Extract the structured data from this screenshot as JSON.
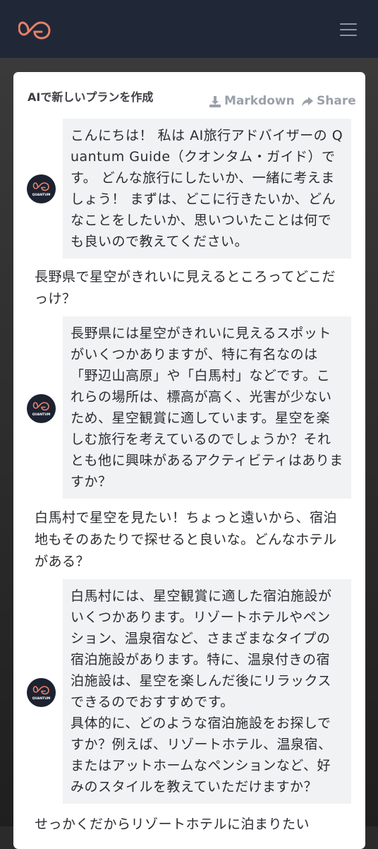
{
  "header": {
    "logo_name": "quantum-guide-logo",
    "menu_icon": "hamburger-menu-icon"
  },
  "chat": {
    "title": "AIで新しいプランを作成",
    "actions": {
      "markdown_label": "Markdown",
      "share_label": "Share"
    },
    "messages": [
      {
        "role": "assistant",
        "text": "こんにちは！ 私は AI旅行アドバイザーの Quantum Guide（クオンタム・ガイド）です。 どんな旅行にしたいか、一緒に考えましょう！ まずは、どこに行きたいか、どんなことをしたいか、思いついたことは何でも良いので教えてください。"
      },
      {
        "role": "user",
        "text": "長野県で星空がきれいに見えるところってどこだっけ？"
      },
      {
        "role": "assistant",
        "text": "長野県には星空がきれいに見えるスポットがいくつかありますが、特に有名なのは「野辺山高原」や「白馬村」などです。これらの場所は、標高が高く、光害が少ないため、星空観賞に適しています。星空を楽しむ旅行を考えているのでしょうか？それとも他に興味があるアクティビティはありますか？"
      },
      {
        "role": "user",
        "text": "白馬村で星空を見たい！ちょっと遠いから、宿泊地もそのあたりで探せると良いな。どんなホテルがある？"
      },
      {
        "role": "assistant",
        "text": "白馬村には、星空観賞に適した宿泊施設がいくつかあります。リゾートホテルやペンション、温泉宿など、さまざまなタイプの宿泊施設があります。特に、温泉付きの宿泊施設は、星空を楽しんだ後にリラックスできるのでおすすめです。\n具体的に、どのような宿泊施設をお探しですか？例えば、リゾートホテル、温泉宿、またはアットホームなペンションなど、好みのスタイルを教えていただけますか？"
      },
      {
        "role": "user",
        "text": "せっかくだからリゾートホテルに泊まりたい"
      }
    ],
    "avatar_caption": "QUANTUM"
  },
  "colors": {
    "header_bg": "#202837",
    "logo_accent": "#e8806b",
    "bubble_bg": "#f1f2f4",
    "muted_action": "#9aa1aa"
  }
}
